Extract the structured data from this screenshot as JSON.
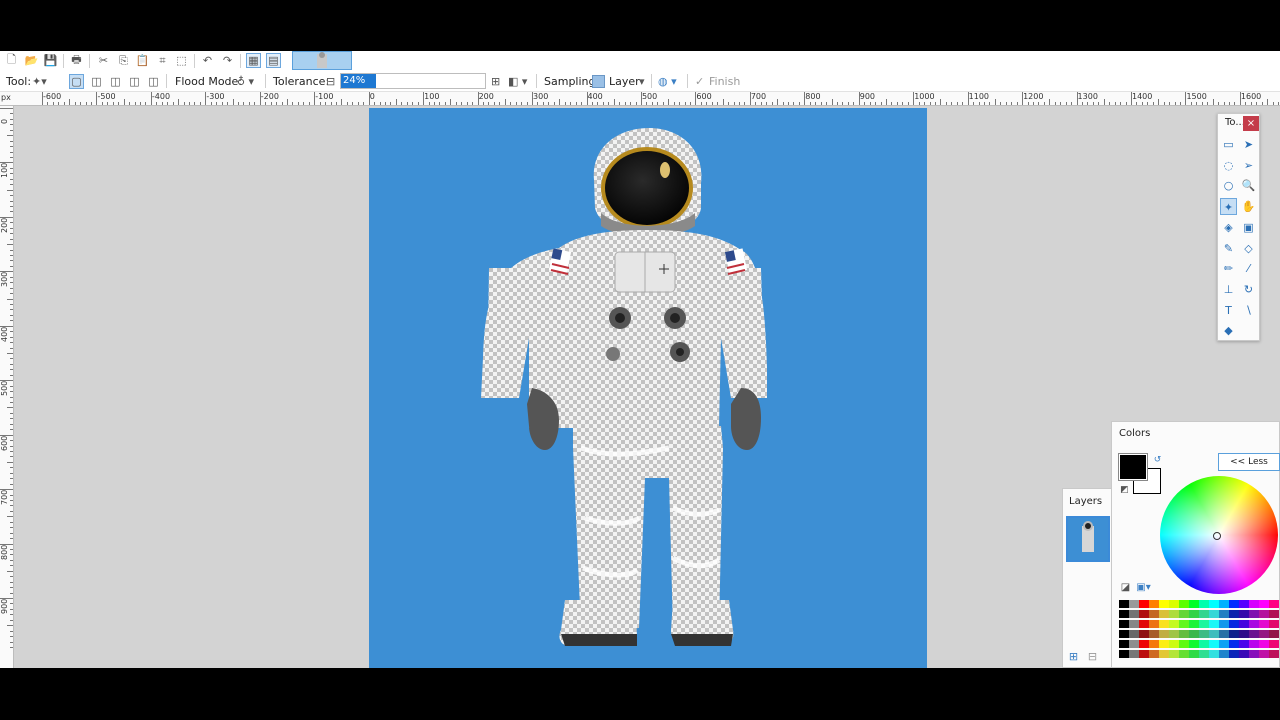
{
  "toolbar2": {
    "tool_label": "Tool:",
    "flood_mode_label": "Flood Mode:",
    "tolerance_label": "Tolerance:",
    "tolerance_value": "24%",
    "tolerance_percent": 24,
    "sampling_label": "Sampling:",
    "sampling_value": "Layer",
    "finish_label": "Finish"
  },
  "ruler": {
    "unit": "px",
    "h_labels": [
      "-600",
      "-500",
      "-400",
      "-300",
      "-200",
      "-100",
      "0",
      "100",
      "200",
      "300",
      "400",
      "500",
      "600",
      "700",
      "800",
      "900",
      "1000",
      "1100",
      "1200",
      "1300",
      "1400",
      "1500",
      "1600"
    ],
    "v_labels": [
      "0",
      "100",
      "200",
      "300",
      "400",
      "500",
      "600",
      "700",
      "800",
      "900"
    ]
  },
  "tools_panel": {
    "title": "To...",
    "close": "×",
    "tools": [
      {
        "name": "rectangle-select-tool",
        "glyph": "▭"
      },
      {
        "name": "move-selected-tool",
        "glyph": "➤"
      },
      {
        "name": "lasso-select-tool",
        "glyph": "◌"
      },
      {
        "name": "move-selection-tool",
        "glyph": "➢"
      },
      {
        "name": "ellipse-select-tool",
        "glyph": "○"
      },
      {
        "name": "zoom-tool",
        "glyph": "🔍"
      },
      {
        "name": "magic-wand-tool",
        "glyph": "✦"
      },
      {
        "name": "pan-tool",
        "glyph": "✋"
      },
      {
        "name": "paint-bucket-tool",
        "glyph": "◈"
      },
      {
        "name": "gradient-tool",
        "glyph": "▣"
      },
      {
        "name": "paintbrush-tool",
        "glyph": "✎"
      },
      {
        "name": "eraser-tool",
        "glyph": "◇"
      },
      {
        "name": "pencil-tool",
        "glyph": "✏"
      },
      {
        "name": "color-picker-tool",
        "glyph": "⁄"
      },
      {
        "name": "clone-stamp-tool",
        "glyph": "⊥"
      },
      {
        "name": "recolor-tool",
        "glyph": "↻"
      },
      {
        "name": "text-tool",
        "glyph": "T"
      },
      {
        "name": "line-curve-tool",
        "glyph": "∖"
      },
      {
        "name": "shapes-tool",
        "glyph": "◆"
      }
    ]
  },
  "colors_panel": {
    "title": "Colors",
    "less_button": "<< Less",
    "primary": "#000000",
    "secondary": "#ffffff"
  },
  "layers_panel": {
    "title": "Layers"
  },
  "colors": {
    "canvas_bg": "#3d8fd4",
    "accent": "#1e78d2"
  }
}
